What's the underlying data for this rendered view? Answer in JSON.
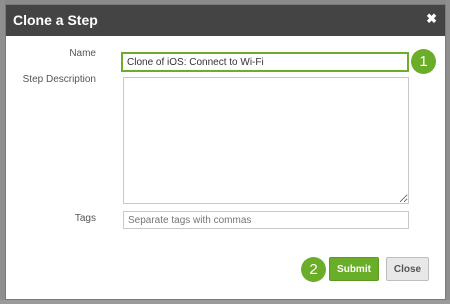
{
  "dialog": {
    "title": "Clone a Step",
    "close_icon": "✖"
  },
  "form": {
    "name_label": "Name",
    "name_value": "Clone of iOS: Connect to Wi-Fi",
    "description_label": "Step Description",
    "description_value": "",
    "tags_label": "Tags",
    "tags_placeholder": "Separate tags with commas"
  },
  "callouts": {
    "step_1": "1",
    "step_2": "2"
  },
  "actions": {
    "submit_label": "Submit",
    "close_label": "Close"
  },
  "colors": {
    "accent": "#6aad28",
    "titlebar": "#444444"
  }
}
